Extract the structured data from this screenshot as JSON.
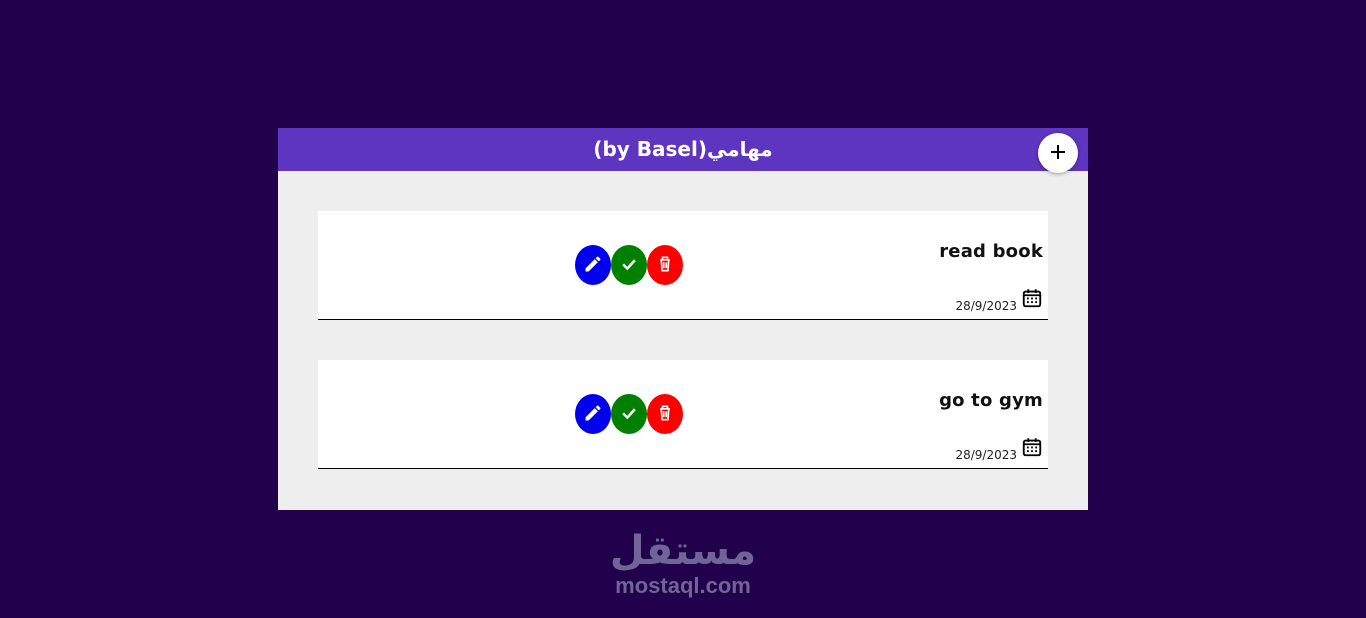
{
  "header": {
    "title": "مهامي(by Basel)",
    "add_icon": "plus-icon"
  },
  "tasks": [
    {
      "title": "read book",
      "date": "28/9/2023",
      "date_icon": "calendar-icon",
      "actions": [
        {
          "name": "edit",
          "icon": "pencil-icon",
          "color": "#0000ee"
        },
        {
          "name": "complete",
          "icon": "check-icon",
          "color": "#008000"
        },
        {
          "name": "delete",
          "icon": "trash-icon",
          "color": "#ff0000"
        }
      ]
    },
    {
      "title": "go to gym",
      "date": "28/9/2023",
      "date_icon": "calendar-icon",
      "actions": [
        {
          "name": "edit",
          "icon": "pencil-icon",
          "color": "#0000ee"
        },
        {
          "name": "complete",
          "icon": "check-icon",
          "color": "#008000"
        },
        {
          "name": "delete",
          "icon": "trash-icon",
          "color": "#ff0000"
        }
      ]
    }
  ],
  "watermark": {
    "arabic": "مستقل",
    "latin": "mostaql.com"
  },
  "colors": {
    "page_background": "#21004c",
    "header_background": "#5e35c1",
    "panel_background": "#eeeeee"
  }
}
